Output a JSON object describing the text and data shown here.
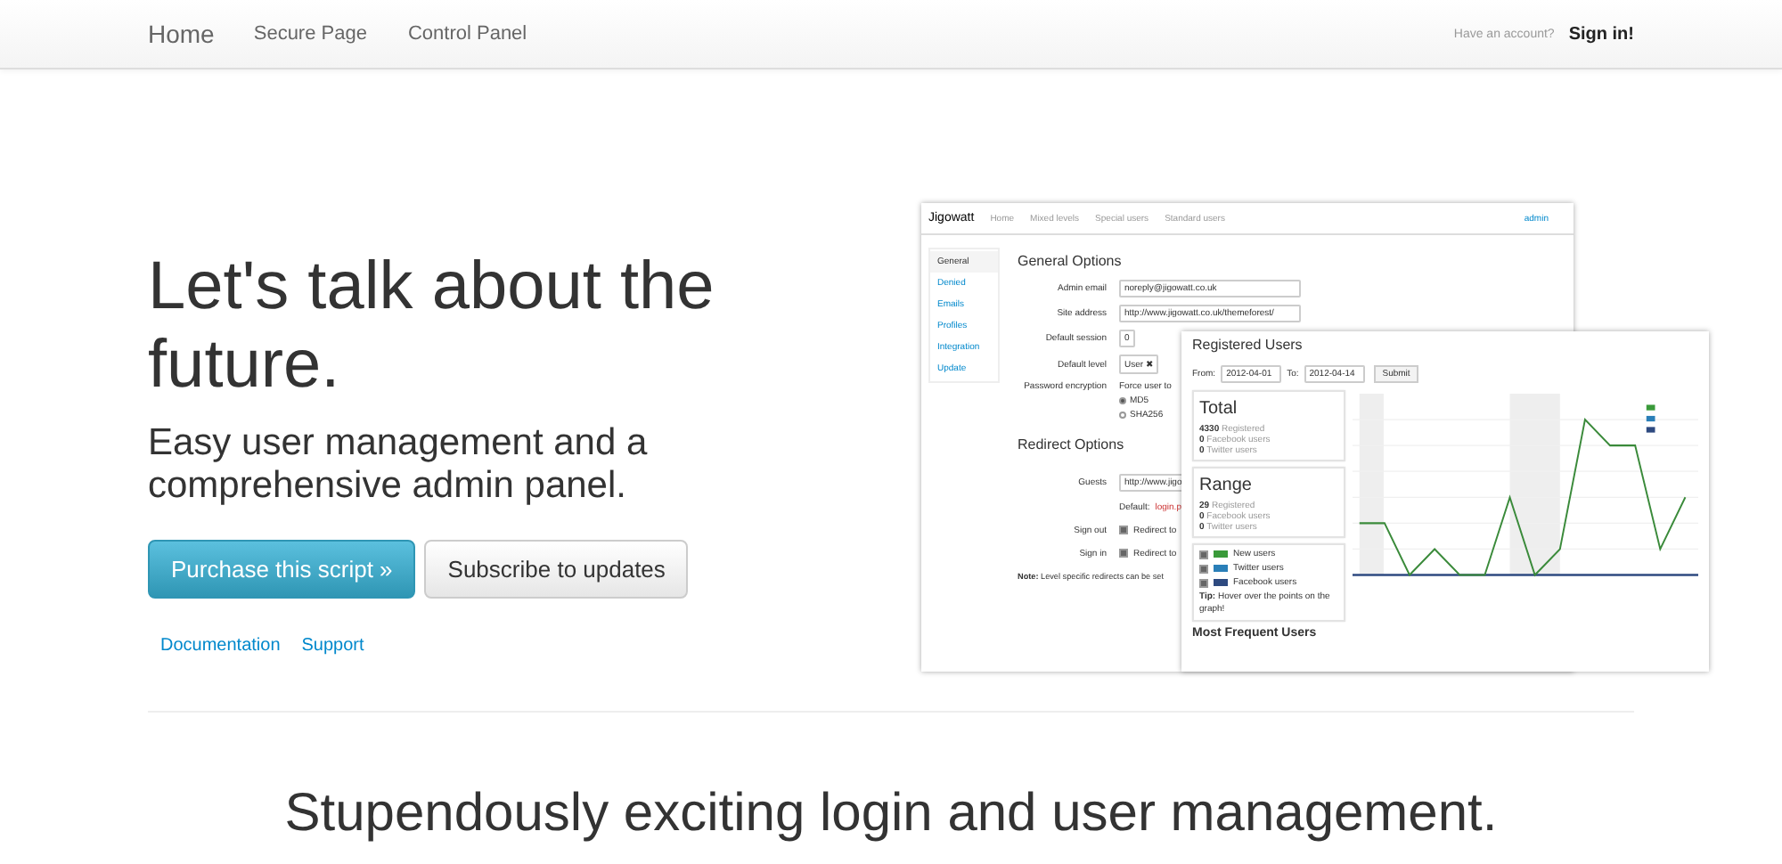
{
  "navbar": {
    "brand": "Home",
    "links": [
      {
        "label": "Secure Page"
      },
      {
        "label": "Control Panel"
      }
    ],
    "account_prompt": "Have an account?",
    "sign_in": "Sign in!"
  },
  "hero": {
    "heading": "Let's talk about the future.",
    "subheading": "Easy user management and a comprehensive admin panel.",
    "buttons": [
      {
        "label": "Purchase this script »",
        "kind": "primary"
      },
      {
        "label": "Subscribe to updates",
        "kind": "default"
      }
    ],
    "links": [
      "Documentation",
      "Support"
    ]
  },
  "preview": {
    "admin_window": {
      "brand": "Jigowatt",
      "nav": [
        "Home",
        "Mixed levels",
        "Special users",
        "Standard users"
      ],
      "user": "admin",
      "sidebar": [
        {
          "label": "General",
          "selected": true
        },
        {
          "label": "Denied",
          "selected": false
        },
        {
          "label": "Emails",
          "selected": false
        },
        {
          "label": "Profiles",
          "selected": false
        },
        {
          "label": "Integration",
          "selected": false
        },
        {
          "label": "Update",
          "selected": false
        }
      ],
      "general_title": "General Options",
      "fields": [
        {
          "label": "Admin email",
          "value": "noreply@jigowatt.co.uk"
        },
        {
          "label": "Site address",
          "value": "http://www.jigowatt.co.uk/themeforest/"
        },
        {
          "label": "Default session",
          "value": "0"
        },
        {
          "label": "Default level",
          "value": "User ✖"
        }
      ],
      "encryption": {
        "label": "Password encryption",
        "force": "Force user to",
        "options": [
          {
            "label": "MD5",
            "selected": true
          },
          {
            "label": "SHA256",
            "selected": false
          }
        ]
      },
      "redirect_title": "Redirect Options",
      "guests": {
        "label": "Guests",
        "value": "http://www.jigo",
        "default": "Default:",
        "default_value": "login.p"
      },
      "redirects": [
        {
          "label": "Sign out",
          "text": "Redirect to",
          "checked": true
        },
        {
          "label": "Sign in",
          "text": "Redirect to",
          "checked": true
        }
      ],
      "note_bold": "Note:",
      "note": "Level specific redirects can be set"
    },
    "stats_window": {
      "title": "Registered Users",
      "from_label": "From:",
      "from": "2012-04-01",
      "to_label": "To:",
      "to": "2012-04-14",
      "submit": "Submit",
      "boxes": [
        {
          "title": "Total",
          "lines": [
            {
              "count": "4330",
              "label": "Registered"
            },
            {
              "count": "0",
              "label": "Facebook users"
            },
            {
              "count": "0",
              "label": "Twitter users"
            }
          ]
        },
        {
          "title": "Range",
          "lines": [
            {
              "count": "29",
              "label": "Registered"
            },
            {
              "count": "0",
              "label": "Facebook users"
            },
            {
              "count": "0",
              "label": "Twitter users"
            }
          ]
        }
      ],
      "legend": [
        {
          "label": "New users",
          "checked": true,
          "color": "#3a9a3a"
        },
        {
          "label": "Twitter users",
          "checked": true,
          "color": "#2a7fb8"
        },
        {
          "label": "Facebook users",
          "checked": true,
          "color": "#2e4a80"
        }
      ],
      "tip_bold": "Tip:",
      "tip": "Hover over the points on the graph!",
      "frequent_title": "Most Frequent Users"
    }
  },
  "tagline": "Stupendously exciting login and user management."
}
